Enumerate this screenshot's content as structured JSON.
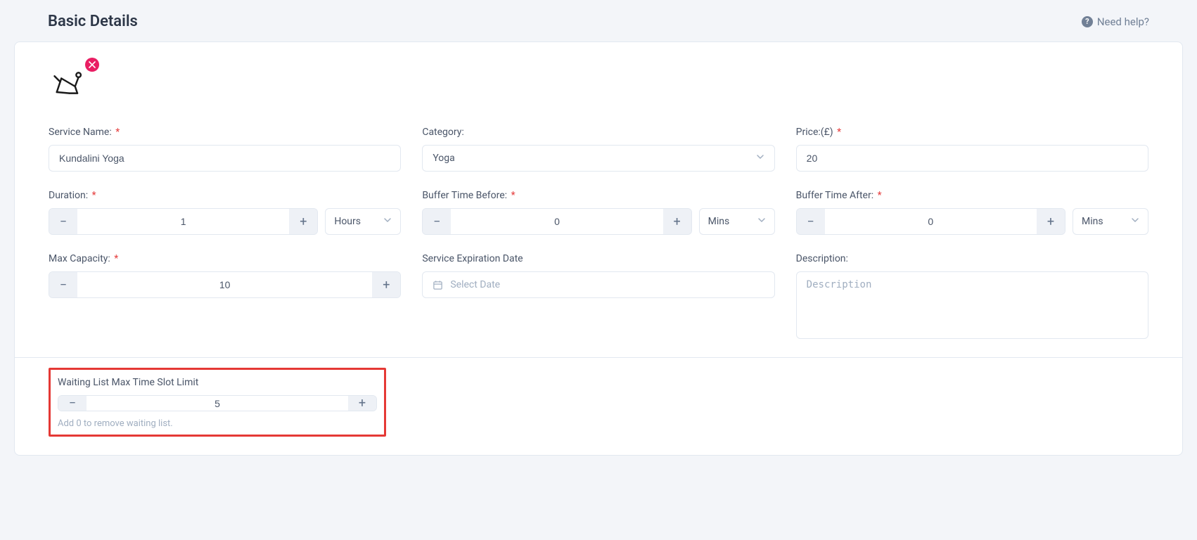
{
  "header": {
    "title": "Basic Details",
    "help": "Need help?"
  },
  "form": {
    "serviceName": {
      "label": "Service Name:",
      "value": "Kundalini Yoga",
      "required": true
    },
    "category": {
      "label": "Category:",
      "value": "Yoga",
      "required": false
    },
    "price": {
      "label": "Price:(£)",
      "value": "20",
      "required": true
    },
    "duration": {
      "label": "Duration:",
      "value": "1",
      "unit": "Hours",
      "required": true
    },
    "bufferBefore": {
      "label": "Buffer Time Before:",
      "value": "0",
      "unit": "Mins",
      "required": true
    },
    "bufferAfter": {
      "label": "Buffer Time After:",
      "value": "0",
      "unit": "Mins",
      "required": true
    },
    "maxCapacity": {
      "label": "Max Capacity:",
      "value": "10",
      "required": true
    },
    "expiration": {
      "label": "Service Expiration Date",
      "placeholder": "Select Date"
    },
    "description": {
      "label": "Description:",
      "placeholder": "Description"
    }
  },
  "waiting": {
    "label": "Waiting List Max Time Slot Limit",
    "value": "5",
    "helper": "Add 0 to remove waiting list."
  },
  "glyphs": {
    "minus": "−",
    "plus": "+",
    "asterisk": "*"
  }
}
